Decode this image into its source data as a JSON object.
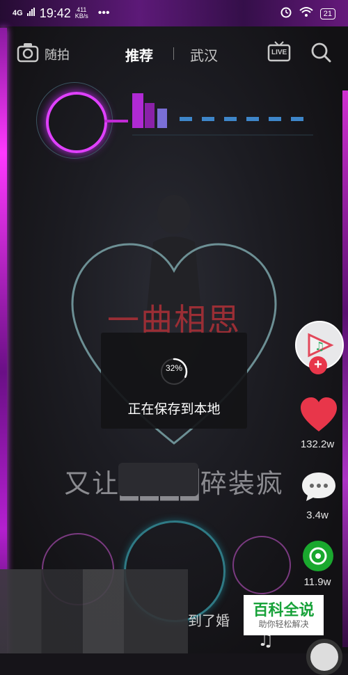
{
  "status_bar": {
    "network": "4G",
    "time": "19:42",
    "speed_value": "411",
    "speed_unit": "KB/s",
    "battery": "21"
  },
  "nav": {
    "camera_label": "随拍",
    "tabs": [
      {
        "label": "推荐"
      },
      {
        "label": "武汉"
      }
    ],
    "live_label": "LIVE"
  },
  "video": {
    "song_title": "一曲相思",
    "subtitle": "又让████碎装疯",
    "caption_fragment": "到了婚"
  },
  "save_toast": {
    "progress_text": "32%",
    "progress_value": 0.32,
    "message": "正在保存到本地"
  },
  "side_rail": {
    "likes": "132.2w",
    "comments": "3.4w",
    "shares": "11.9w"
  },
  "watermark": {
    "title": "百科全说",
    "subtitle": "助你轻松解决"
  },
  "colors": {
    "like": "#e8364a",
    "share": "#1aa82e",
    "accent": "#e040ff"
  }
}
